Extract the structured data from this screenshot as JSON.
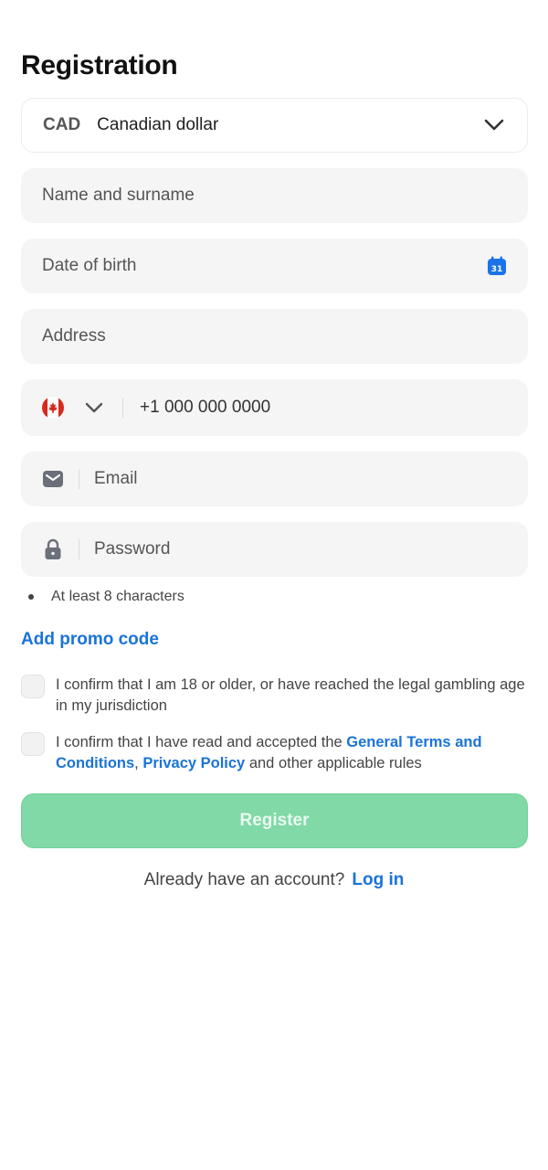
{
  "page": {
    "title": "Registration"
  },
  "currency": {
    "code": "CAD",
    "name": "Canadian dollar",
    "icon": "chevron-down-icon"
  },
  "fields": {
    "name_placeholder": "Name and surname",
    "dob_placeholder": "Date of birth",
    "dob_icon_day": "31",
    "address_placeholder": "Address",
    "phone_value": "+1 000 000 0000",
    "phone_country": "Canada",
    "email_placeholder": "Email",
    "password_placeholder": "Password"
  },
  "password_rules": [
    "At least 8 characters"
  ],
  "promo": {
    "label": "Add promo code"
  },
  "consents": {
    "age": "I confirm that I am 18 or older, or have reached the legal gambling age in my jurisdiction",
    "terms_prefix": "I confirm that I have read and accepted the ",
    "terms_link": "General Terms and Conditions",
    "terms_sep": ", ",
    "privacy_link": "Privacy Policy",
    "terms_suffix": " and other applicable rules"
  },
  "register": {
    "label": "Register"
  },
  "login": {
    "prompt": "Already have an account?",
    "link": "Log in"
  },
  "colors": {
    "accent_link": "#1a73d9",
    "register_bg": "#80d9a6",
    "field_bg": "#f5f5f5",
    "calendar_icon": "#1a73e8",
    "flag_red": "#d52b1e"
  }
}
